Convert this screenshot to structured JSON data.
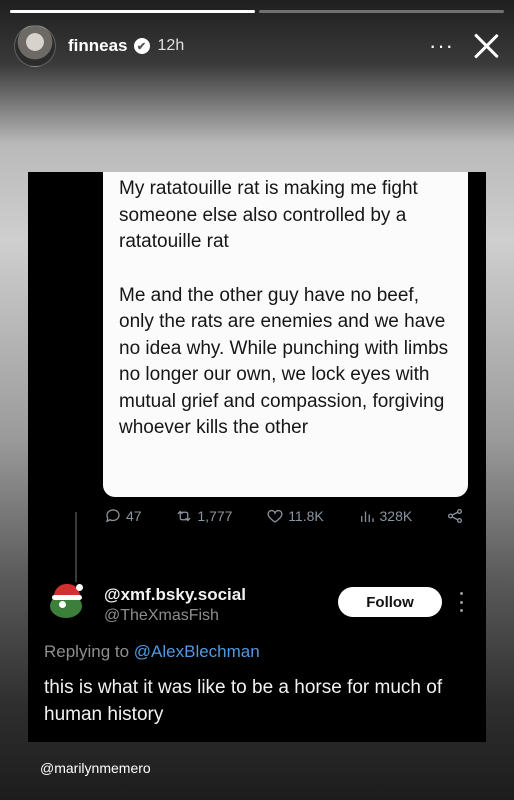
{
  "story": {
    "progress": [
      {
        "fill": 1.0
      },
      {
        "fill": 0.0
      }
    ],
    "username": "finneas",
    "verified_glyph": "✔",
    "time": "12h",
    "more_icon": "···",
    "credit": "@marilynmemero"
  },
  "post": {
    "quote_paragraphs": [
      "My ratatouille rat is making me fight someone else also controlled by a ratatouille rat",
      "Me and the other guy have no beef, only the rats are enemies and we have no idea why. While punching with limbs no longer our own, we lock eyes with mutual grief and compassion, forgiving whoever kills the other"
    ],
    "metrics": {
      "replies": "47",
      "reposts": "1,777",
      "likes": "11.8K",
      "views": "328K"
    },
    "reply": {
      "display_name": "@xmf.bsky.social",
      "handle": "@TheXmasFish",
      "follow_label": "Follow",
      "replying_prefix": "Replying to ",
      "replying_to": "@AlexBlechman",
      "text": "this is what it was like to be a horse for much of human history"
    }
  },
  "colors": {
    "accent_link": "#4f9ae0",
    "metric_gray": "#8b95a0"
  }
}
